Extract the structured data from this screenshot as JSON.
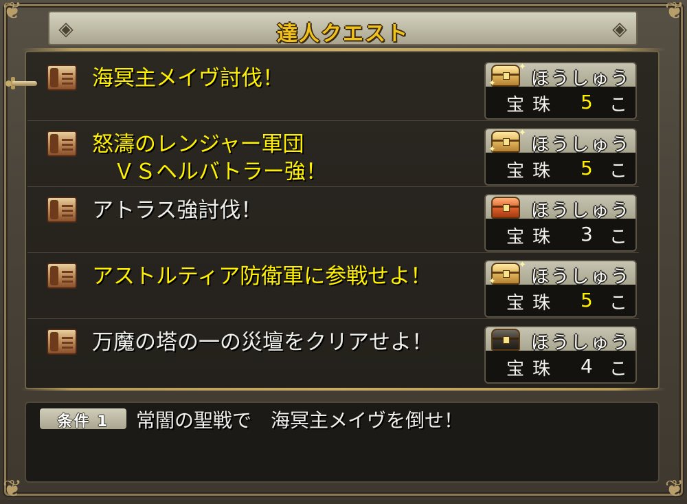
{
  "window": {
    "title": "達人クエスト"
  },
  "quests": [
    {
      "title": "海冥主メイヴ討伐！",
      "title_color": "yellow",
      "reward_label": "ほうしゅう",
      "chest": "gold",
      "item": "宝珠",
      "count": "5",
      "count_color": "yellow",
      "unit": "こ"
    },
    {
      "title": "怒濤のレンジャー軍団\n　ＶＳヘルバトラー強！",
      "title_color": "yellow",
      "reward_label": "ほうしゅう",
      "chest": "gold",
      "item": "宝珠",
      "count": "5",
      "count_color": "yellow",
      "unit": "こ"
    },
    {
      "title": "アトラス強討伐！",
      "title_color": "white",
      "reward_label": "ほうしゅう",
      "chest": "red",
      "item": "宝珠",
      "count": "3",
      "count_color": "white",
      "unit": "こ"
    },
    {
      "title": "アストルティア防衛軍に参戦せよ！",
      "title_color": "yellow",
      "reward_label": "ほうしゅう",
      "chest": "gold",
      "item": "宝珠",
      "count": "5",
      "count_color": "yellow",
      "unit": "こ"
    },
    {
      "title": "万魔の塔の一の災壇をクリアせよ！",
      "title_color": "white",
      "reward_label": "ほうしゅう",
      "chest": "black",
      "item": "宝珠",
      "count": "4",
      "count_color": "white",
      "unit": "こ"
    }
  ],
  "selected_index": 0,
  "condition": {
    "badge": "条件 1",
    "text": "常闇の聖戦で　海冥主メイヴを倒せ！"
  },
  "colors": {
    "title_gold": "#f2c21c",
    "highlight_yellow": "#fff100",
    "text_white": "#eeeeea"
  }
}
